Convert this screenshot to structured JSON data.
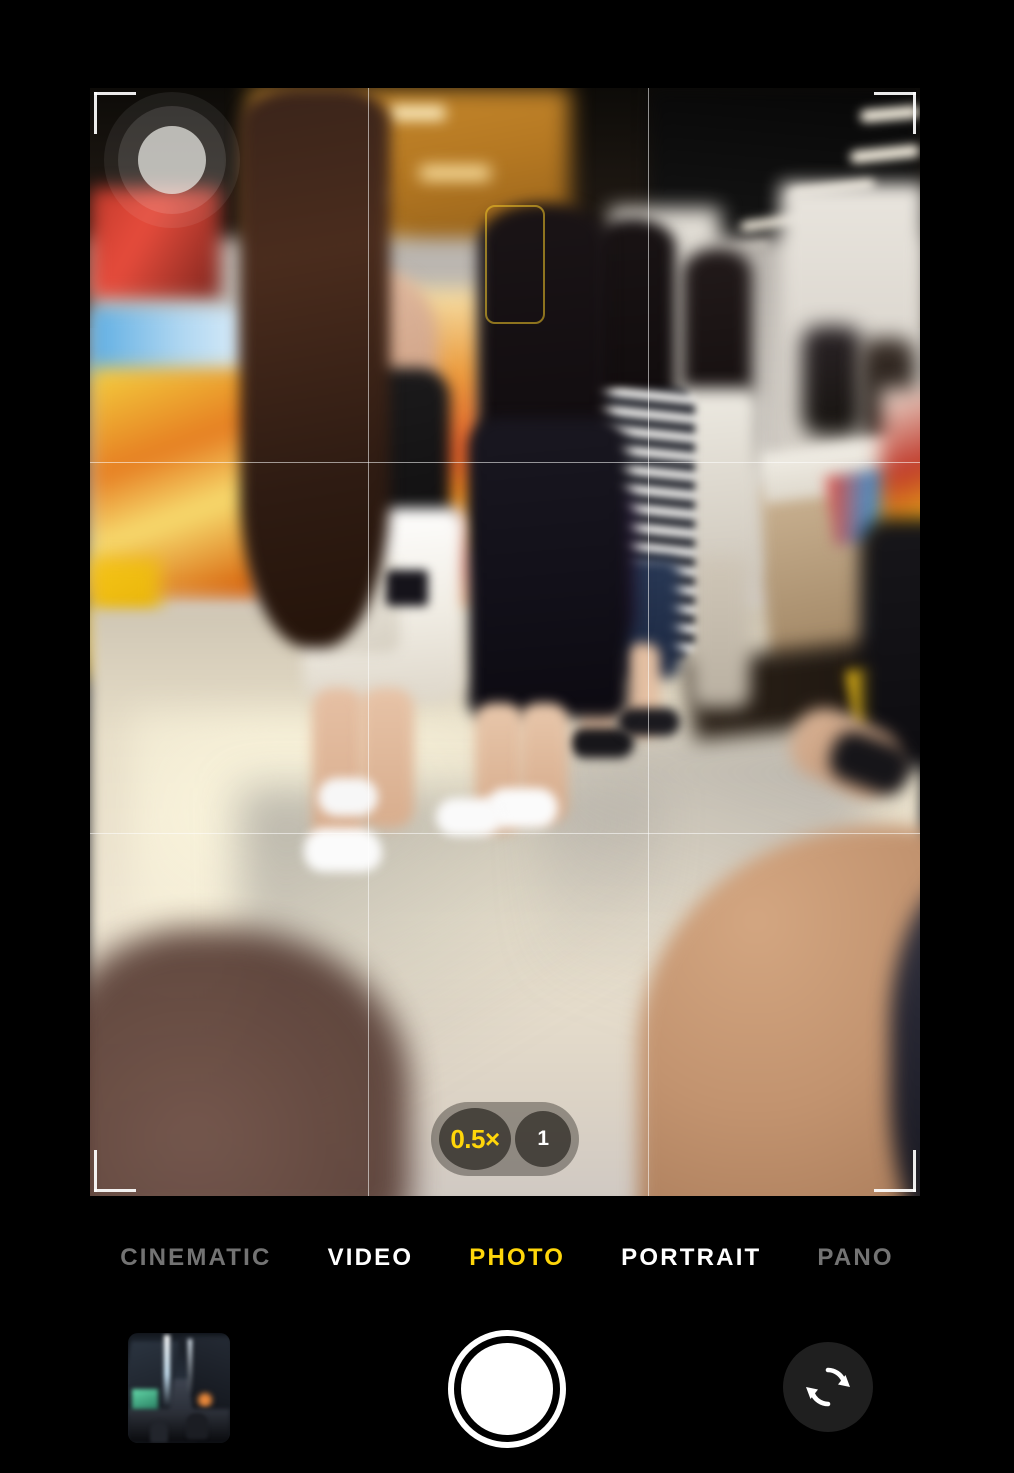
{
  "app": {
    "name": "Camera",
    "platform": "iOS"
  },
  "viewfinder": {
    "grid_enabled": true,
    "grid_name": "rule-of-thirds-grid",
    "framing_brackets": true,
    "scene_description": "Motion-blurred handheld shot inside a brightly lit shopping mall store. Two women in the foreground — one with long brown hair in a black top, white shorts and a white crossbody bag, the other with long black hair in a black dress — stand on a glossy cream tiled floor. Behind them are colorful product shelves, a wooden display counter, people in striped shirts, and ceiling fluorescent strip lights. A blurred finger partially obstructs the lower right of the lens.",
    "focus_box": {
      "name": "autofocus-box",
      "color": "#f0c428",
      "visible": true
    },
    "lens_overlay": {
      "name": "lens-overlay-circle",
      "visible": true
    }
  },
  "zoom_control": {
    "name": "zoom-level-selector",
    "options": [
      {
        "label": "0.5×",
        "value": "0.5",
        "selected": true,
        "color": "#ffd60a"
      },
      {
        "label": "1",
        "value": "1",
        "selected": false,
        "color": "#ffffff"
      }
    ]
  },
  "mode_selector": {
    "name": "capture-mode-selector",
    "selected": "PHOTO",
    "modes": [
      {
        "label": "CINEMATIC",
        "state": "dim"
      },
      {
        "label": "VIDEO",
        "state": "normal"
      },
      {
        "label": "PHOTO",
        "state": "selected"
      },
      {
        "label": "PORTRAIT",
        "state": "normal"
      },
      {
        "label": "PANO",
        "state": "dim"
      }
    ]
  },
  "bottom_bar": {
    "photo_library_thumbnail": {
      "name": "photo-library-thumbnail",
      "description": "Night street scene with crowd and bright lights"
    },
    "shutter_button": {
      "name": "shutter-button",
      "label": "Take Photo"
    },
    "camera_flip_button": {
      "name": "camera-flip-button",
      "icon": "camera-rotate-icon",
      "label": "Switch Camera"
    }
  },
  "colors": {
    "accent_yellow": "#ffd60a",
    "background": "#000000",
    "text_primary": "#ffffff",
    "text_dim": "rgba(255,255,255,0.45)"
  }
}
